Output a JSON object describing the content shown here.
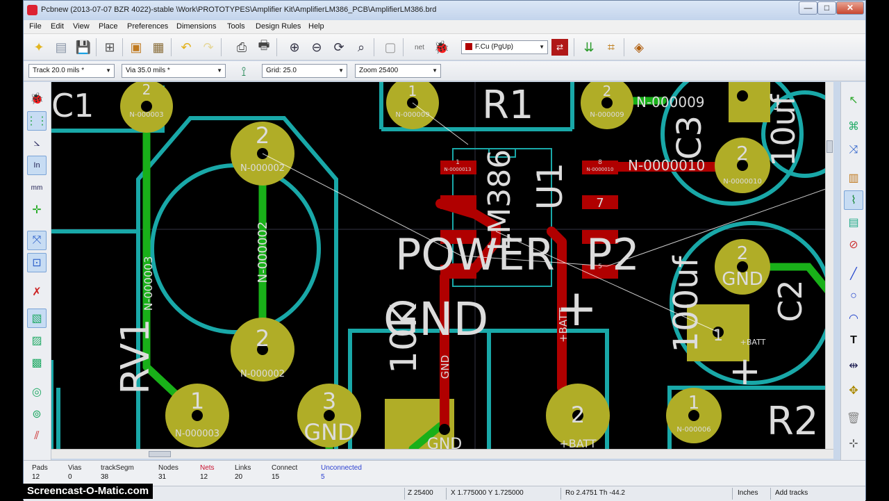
{
  "window": {
    "title": "Pcbnew (2013-07-07 BZR 4022)-stable \\Work\\PROTOTYPES\\Amplifier Kit\\AmplifierLM386_PCB\\AmplifierLM386.brd",
    "min_label": "—",
    "max_label": "□",
    "close_label": "✕"
  },
  "menu": [
    "File",
    "Edit",
    "View",
    "Place",
    "Preferences",
    "Dimensions",
    "Tools",
    "Design Rules",
    "Help"
  ],
  "toolbar": {
    "netlist_label": "net",
    "layer_select": "F.Cu (PgUp)",
    "track_select": "Track 20.0 mils *",
    "via_select": "Via 35.0 mils *",
    "grid_select": "Grid: 25.0",
    "zoom_select": "Zoom 25400"
  },
  "board": {
    "refs": {
      "c1": "C1",
      "r1": "R1",
      "c3": "C3",
      "c3_val": "10uf",
      "u1": "U1",
      "u1_val": "LM386",
      "rv1": "RV1",
      "p2": "P2",
      "c2": "C2",
      "c2_val": "100uf",
      "r2": "R2",
      "power": "POWER",
      "gnd_big": "GND",
      "plus": "+",
      "one_k": "10K"
    },
    "nets": {
      "n3": "N-000003",
      "n9": "N-000009",
      "n2": "N-000002",
      "n10": "N-0000010",
      "n6": "N-000006",
      "gnd": "GND",
      "batt": "+BATT",
      "ic_n13": "N-0000013",
      "ic_n10": "N-0000010"
    },
    "pads": {
      "one": "1",
      "two": "2",
      "three": "3",
      "seven": "7",
      "eight": "8",
      "five": "5"
    }
  },
  "stats": {
    "headers": [
      "Pads",
      "Vias",
      "trackSegm",
      "Nodes",
      "Nets",
      "Links",
      "Connect",
      "Unconnected"
    ],
    "values": [
      "12",
      "0",
      "38",
      "31",
      "12",
      "20",
      "15",
      "5"
    ]
  },
  "status": {
    "zoom": "Z 25400",
    "xy": "X 1.775000  Y 1.725000",
    "polar": "Ro 2.4751  Th -44.2",
    "units": "Inches",
    "mode": "Add tracks"
  },
  "watermark": "Screencast-O-Matic.com",
  "colors": {
    "pad": "#b0ad27",
    "silk": "#19a8a8",
    "track_red": "#b00000",
    "track_green": "#19b019",
    "text": "#dcdcdc"
  }
}
